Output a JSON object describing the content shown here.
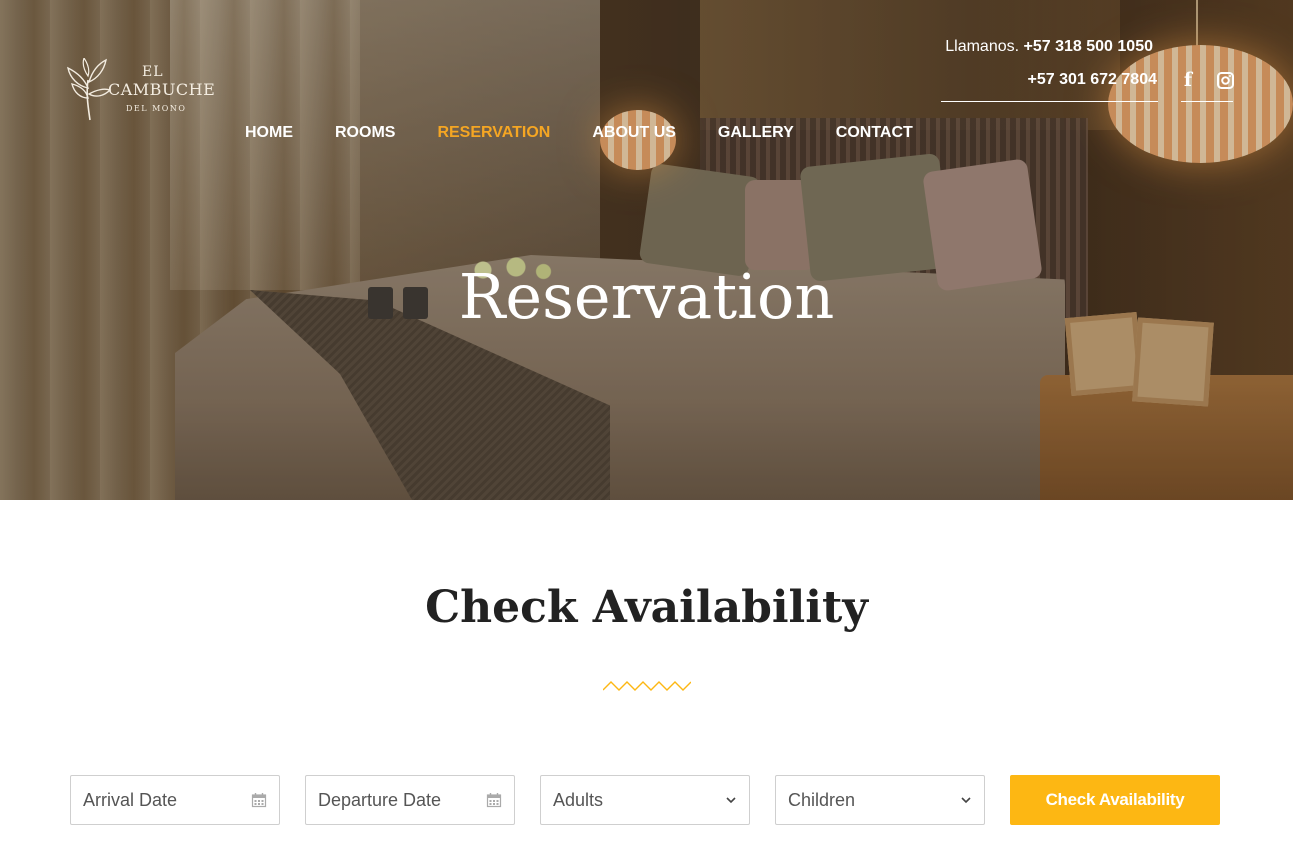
{
  "brand": {
    "logo_el": "EL",
    "logo_name": "CAMBUCHE",
    "logo_sub": "DEL MONO"
  },
  "contact": {
    "label": "Llamanos.",
    "phone1": "+57 318 500 1050",
    "phone2": "+57 301 672 7804"
  },
  "social": {
    "facebook_icon": "facebook-icon",
    "instagram_icon": "instagram-icon"
  },
  "nav": {
    "items": [
      {
        "label": "HOME"
      },
      {
        "label": "ROOMS"
      },
      {
        "label": "RESERVATION"
      },
      {
        "label": "ABOUT US"
      },
      {
        "label": "GALLERY"
      },
      {
        "label": "CONTACT"
      }
    ],
    "active_index": 2
  },
  "hero": {
    "title": "Reservation"
  },
  "availability": {
    "title": "Check Availability",
    "arrival_placeholder": "Arrival Date",
    "departure_placeholder": "Departure Date",
    "adults_selected": "Adults",
    "children_selected": "Children",
    "submit_label": "Check Availability"
  },
  "colors": {
    "accent": "#fdb713",
    "nav_active": "#f5a623",
    "heading": "#222222"
  }
}
